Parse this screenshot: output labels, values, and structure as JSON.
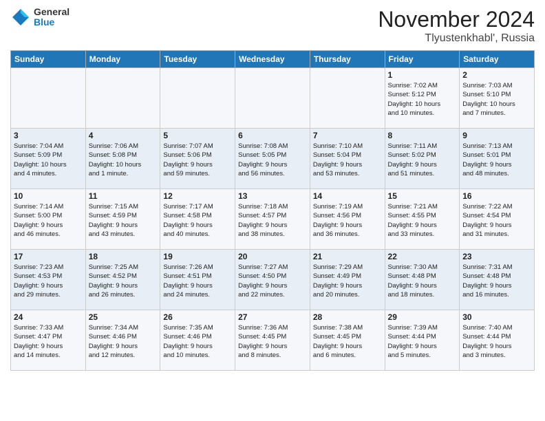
{
  "header": {
    "logo_general": "General",
    "logo_blue": "Blue",
    "month_title": "November 2024",
    "location": "Tlyustenkhabl', Russia"
  },
  "weekdays": [
    "Sunday",
    "Monday",
    "Tuesday",
    "Wednesday",
    "Thursday",
    "Friday",
    "Saturday"
  ],
  "weeks": [
    [
      {
        "day": "",
        "info": ""
      },
      {
        "day": "",
        "info": ""
      },
      {
        "day": "",
        "info": ""
      },
      {
        "day": "",
        "info": ""
      },
      {
        "day": "",
        "info": ""
      },
      {
        "day": "1",
        "info": "Sunrise: 7:02 AM\nSunset: 5:12 PM\nDaylight: 10 hours\nand 10 minutes."
      },
      {
        "day": "2",
        "info": "Sunrise: 7:03 AM\nSunset: 5:10 PM\nDaylight: 10 hours\nand 7 minutes."
      }
    ],
    [
      {
        "day": "3",
        "info": "Sunrise: 7:04 AM\nSunset: 5:09 PM\nDaylight: 10 hours\nand 4 minutes."
      },
      {
        "day": "4",
        "info": "Sunrise: 7:06 AM\nSunset: 5:08 PM\nDaylight: 10 hours\nand 1 minute."
      },
      {
        "day": "5",
        "info": "Sunrise: 7:07 AM\nSunset: 5:06 PM\nDaylight: 9 hours\nand 59 minutes."
      },
      {
        "day": "6",
        "info": "Sunrise: 7:08 AM\nSunset: 5:05 PM\nDaylight: 9 hours\nand 56 minutes."
      },
      {
        "day": "7",
        "info": "Sunrise: 7:10 AM\nSunset: 5:04 PM\nDaylight: 9 hours\nand 53 minutes."
      },
      {
        "day": "8",
        "info": "Sunrise: 7:11 AM\nSunset: 5:02 PM\nDaylight: 9 hours\nand 51 minutes."
      },
      {
        "day": "9",
        "info": "Sunrise: 7:13 AM\nSunset: 5:01 PM\nDaylight: 9 hours\nand 48 minutes."
      }
    ],
    [
      {
        "day": "10",
        "info": "Sunrise: 7:14 AM\nSunset: 5:00 PM\nDaylight: 9 hours\nand 46 minutes."
      },
      {
        "day": "11",
        "info": "Sunrise: 7:15 AM\nSunset: 4:59 PM\nDaylight: 9 hours\nand 43 minutes."
      },
      {
        "day": "12",
        "info": "Sunrise: 7:17 AM\nSunset: 4:58 PM\nDaylight: 9 hours\nand 40 minutes."
      },
      {
        "day": "13",
        "info": "Sunrise: 7:18 AM\nSunset: 4:57 PM\nDaylight: 9 hours\nand 38 minutes."
      },
      {
        "day": "14",
        "info": "Sunrise: 7:19 AM\nSunset: 4:56 PM\nDaylight: 9 hours\nand 36 minutes."
      },
      {
        "day": "15",
        "info": "Sunrise: 7:21 AM\nSunset: 4:55 PM\nDaylight: 9 hours\nand 33 minutes."
      },
      {
        "day": "16",
        "info": "Sunrise: 7:22 AM\nSunset: 4:54 PM\nDaylight: 9 hours\nand 31 minutes."
      }
    ],
    [
      {
        "day": "17",
        "info": "Sunrise: 7:23 AM\nSunset: 4:53 PM\nDaylight: 9 hours\nand 29 minutes."
      },
      {
        "day": "18",
        "info": "Sunrise: 7:25 AM\nSunset: 4:52 PM\nDaylight: 9 hours\nand 26 minutes."
      },
      {
        "day": "19",
        "info": "Sunrise: 7:26 AM\nSunset: 4:51 PM\nDaylight: 9 hours\nand 24 minutes."
      },
      {
        "day": "20",
        "info": "Sunrise: 7:27 AM\nSunset: 4:50 PM\nDaylight: 9 hours\nand 22 minutes."
      },
      {
        "day": "21",
        "info": "Sunrise: 7:29 AM\nSunset: 4:49 PM\nDaylight: 9 hours\nand 20 minutes."
      },
      {
        "day": "22",
        "info": "Sunrise: 7:30 AM\nSunset: 4:48 PM\nDaylight: 9 hours\nand 18 minutes."
      },
      {
        "day": "23",
        "info": "Sunrise: 7:31 AM\nSunset: 4:48 PM\nDaylight: 9 hours\nand 16 minutes."
      }
    ],
    [
      {
        "day": "24",
        "info": "Sunrise: 7:33 AM\nSunset: 4:47 PM\nDaylight: 9 hours\nand 14 minutes."
      },
      {
        "day": "25",
        "info": "Sunrise: 7:34 AM\nSunset: 4:46 PM\nDaylight: 9 hours\nand 12 minutes."
      },
      {
        "day": "26",
        "info": "Sunrise: 7:35 AM\nSunset: 4:46 PM\nDaylight: 9 hours\nand 10 minutes."
      },
      {
        "day": "27",
        "info": "Sunrise: 7:36 AM\nSunset: 4:45 PM\nDaylight: 9 hours\nand 8 minutes."
      },
      {
        "day": "28",
        "info": "Sunrise: 7:38 AM\nSunset: 4:45 PM\nDaylight: 9 hours\nand 6 minutes."
      },
      {
        "day": "29",
        "info": "Sunrise: 7:39 AM\nSunset: 4:44 PM\nDaylight: 9 hours\nand 5 minutes."
      },
      {
        "day": "30",
        "info": "Sunrise: 7:40 AM\nSunset: 4:44 PM\nDaylight: 9 hours\nand 3 minutes."
      }
    ]
  ]
}
